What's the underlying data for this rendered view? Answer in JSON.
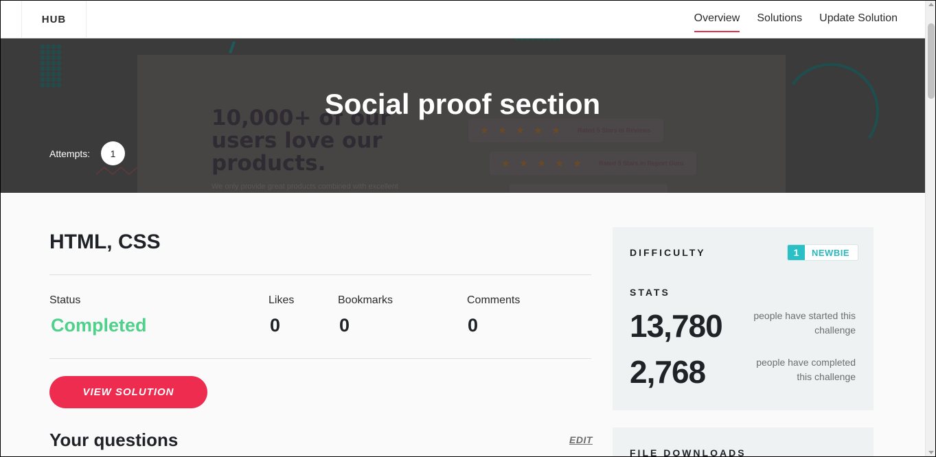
{
  "nav": {
    "logo": "HUB",
    "links": [
      "Overview",
      "Solutions",
      "Update Solution"
    ],
    "active": "Overview"
  },
  "hero": {
    "title": "Social proof section",
    "attempts_label": "Attempts:",
    "attempts_count": "1",
    "preview": {
      "headline": [
        "10,000+ of our",
        "users love our",
        "products."
      ],
      "subtext": "We only provide great products combined with excellent",
      "review_1": "Rated 5 Stars in Reviews",
      "review_2": "Rated 5 Stars in Report Guru",
      "stars": "★ ★ ★ ★ ★"
    }
  },
  "main": {
    "languages": "HTML, CSS",
    "stats": {
      "status_label": "Status",
      "status_value": "Completed",
      "likes_label": "Likes",
      "likes_value": "0",
      "bookmarks_label": "Bookmarks",
      "bookmarks_value": "0",
      "comments_label": "Comments",
      "comments_value": "0"
    },
    "view_solution_label": "VIEW SOLUTION",
    "questions_heading": "Your questions",
    "edit_label": "EDIT"
  },
  "sidebar": {
    "difficulty_heading": "DIFFICULTY",
    "difficulty_level": "1",
    "difficulty_name": "NEWBIE",
    "stats_heading": "STATS",
    "started_count": "13,780",
    "started_desc": "people have started this challenge",
    "completed_count": "2,768",
    "completed_desc": "people have completed this challenge",
    "downloads_heading": "FILE DOWNLOADS"
  },
  "colors": {
    "accent": "#ee2c4f",
    "completed": "#4fd18b",
    "newbie": "#2bc0c6"
  }
}
